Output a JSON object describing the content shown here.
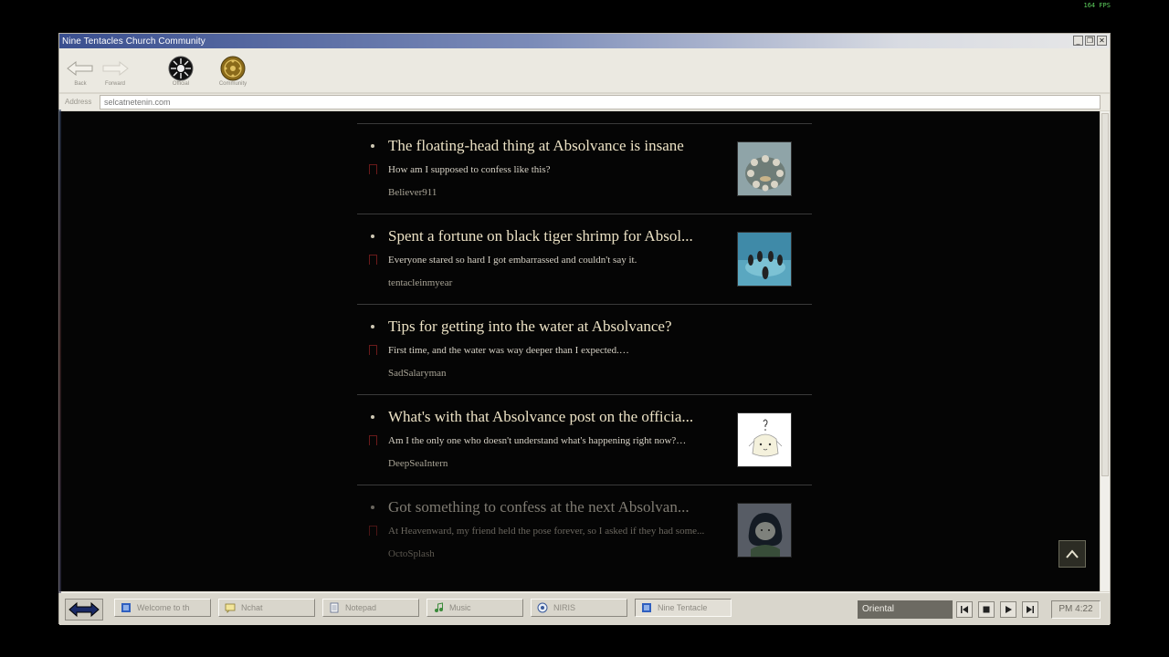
{
  "overlay": {
    "fps": "164 FPS"
  },
  "window": {
    "title": "Nine Tentacles Church Community",
    "controls": [
      "minimize",
      "restore",
      "close"
    ]
  },
  "toolbar": {
    "back_label": "Back",
    "forward_label": "Forward",
    "official_label": "Official",
    "community_label": "Community"
  },
  "address": {
    "label": "Address",
    "value": "selcatnetenin.com"
  },
  "posts": [
    {
      "title": "The floating-head thing at Absolvance is insane",
      "excerpt": "How am I supposed to confess like this?",
      "author": "Believer911",
      "thumbnail": "circle-of-people-photo"
    },
    {
      "title": "Spent a fortune on black tiger shrimp for Absol...",
      "excerpt": "Everyone stared so hard I got embarrassed and couldn't say it.",
      "author": "tentacleinmyear",
      "thumbnail": "water-circle-photo"
    },
    {
      "title": "Tips for getting into the water at Absolvance?",
      "excerpt": "First time, and the water was way deeper than I expected.…",
      "author": "SadSalaryman",
      "thumbnail": null
    },
    {
      "title": "What's with that Absolvance post on the officia...",
      "excerpt": "Am I the only one who doesn't understand what's happening right now?…",
      "author": "DeepSeaIntern",
      "thumbnail": "confused-creature-drawing"
    },
    {
      "title": "Got something to confess at the next Absolvan...",
      "excerpt": "At Heavenward, my friend held the pose forever, so I asked if they had some...",
      "author": "OctoSplash",
      "thumbnail": "green-octopus-girl-drawing"
    }
  ],
  "taskbar": {
    "items": [
      {
        "label": "Welcome to th",
        "icon": "window-icon"
      },
      {
        "label": "Nchat",
        "icon": "chat-icon"
      },
      {
        "label": "Notepad",
        "icon": "notepad-icon"
      },
      {
        "label": "Music",
        "icon": "music-icon"
      },
      {
        "label": "NIRIS",
        "icon": "niris-icon"
      },
      {
        "label": "Nine Tentacle",
        "icon": "window-icon"
      }
    ],
    "music_track": "Oriental",
    "clock": "PM 4:22"
  },
  "colors": {
    "content_bg": "#050505",
    "post_title": "#ece2c5",
    "titlebar_start": "#3a4f8f",
    "chrome": "#d9d6cc"
  }
}
